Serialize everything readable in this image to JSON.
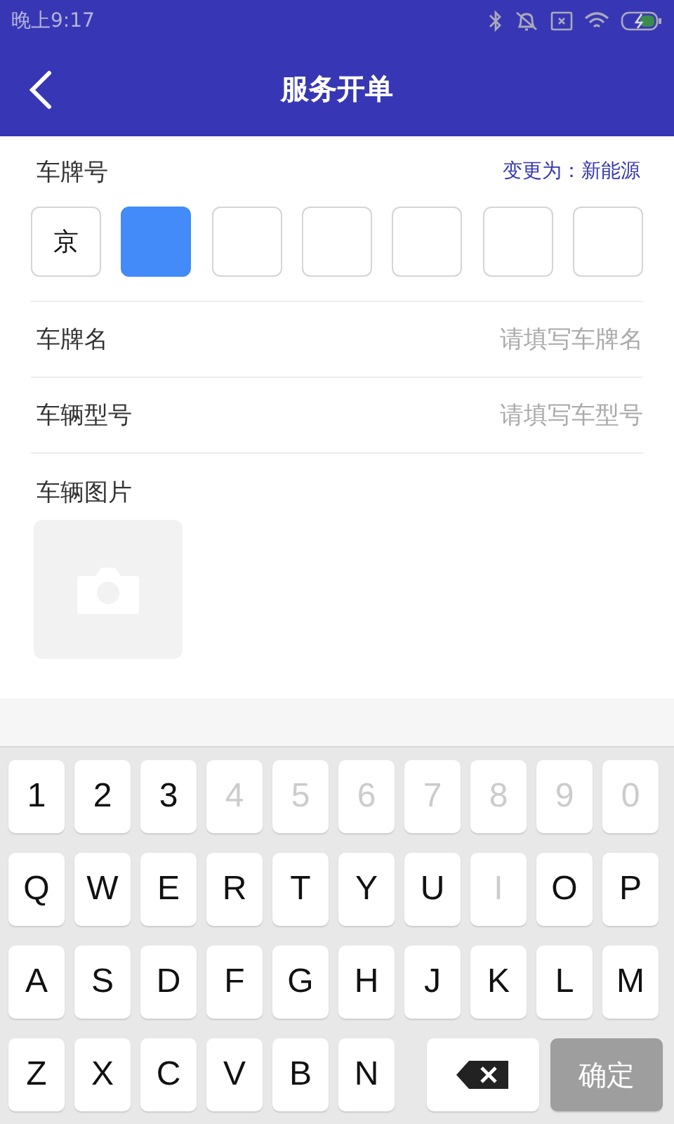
{
  "status_bar": {
    "time": "晚上9:17"
  },
  "header": {
    "title": "服务开单"
  },
  "plate": {
    "label": "车牌号",
    "switch_link": "变更为：新能源",
    "cells": [
      {
        "text": "京",
        "selected": false
      },
      {
        "selected": true
      },
      {
        "selected": false
      },
      {
        "selected": false
      },
      {
        "selected": false
      },
      {
        "selected": false
      },
      {
        "selected": false
      }
    ]
  },
  "fields": [
    {
      "label": "车牌名",
      "placeholder": "请填写车牌名"
    },
    {
      "label": "车辆型号",
      "placeholder": "请填写车型号"
    }
  ],
  "photo": {
    "label": "车辆图片"
  },
  "keyboard": {
    "rows": [
      [
        {
          "kind": "key",
          "label": "1",
          "disabled": false
        },
        {
          "kind": "key",
          "label": "2",
          "disabled": false
        },
        {
          "kind": "key",
          "label": "3",
          "disabled": false
        },
        {
          "kind": "key",
          "label": "4",
          "disabled": true
        },
        {
          "kind": "key",
          "label": "5",
          "disabled": true
        },
        {
          "kind": "key",
          "label": "6",
          "disabled": true
        },
        {
          "kind": "key",
          "label": "7",
          "disabled": true
        },
        {
          "kind": "key",
          "label": "8",
          "disabled": true
        },
        {
          "kind": "key",
          "label": "9",
          "disabled": true
        },
        {
          "kind": "key",
          "label": "0",
          "disabled": true
        }
      ],
      [
        {
          "kind": "key",
          "label": "Q",
          "disabled": false
        },
        {
          "kind": "key",
          "label": "W",
          "disabled": false
        },
        {
          "kind": "key",
          "label": "E",
          "disabled": false
        },
        {
          "kind": "key",
          "label": "R",
          "disabled": false
        },
        {
          "kind": "key",
          "label": "T",
          "disabled": false
        },
        {
          "kind": "key",
          "label": "Y",
          "disabled": false
        },
        {
          "kind": "key",
          "label": "U",
          "disabled": false
        },
        {
          "kind": "key",
          "label": "I",
          "disabled": true
        },
        {
          "kind": "key",
          "label": "O",
          "disabled": false
        },
        {
          "kind": "key",
          "label": "P",
          "disabled": false
        }
      ],
      [
        {
          "kind": "key",
          "label": "A",
          "disabled": false
        },
        {
          "kind": "key",
          "label": "S",
          "disabled": false
        },
        {
          "kind": "key",
          "label": "D",
          "disabled": false
        },
        {
          "kind": "key",
          "label": "F",
          "disabled": false
        },
        {
          "kind": "key",
          "label": "G",
          "disabled": false
        },
        {
          "kind": "key",
          "label": "H",
          "disabled": false
        },
        {
          "kind": "key",
          "label": "J",
          "disabled": false
        },
        {
          "kind": "key",
          "label": "K",
          "disabled": false
        },
        {
          "kind": "key",
          "label": "L",
          "disabled": false
        },
        {
          "kind": "key",
          "label": "M",
          "disabled": false
        }
      ],
      [
        {
          "kind": "key",
          "label": "Z",
          "disabled": false
        },
        {
          "kind": "key",
          "label": "X",
          "disabled": false
        },
        {
          "kind": "key",
          "label": "C",
          "disabled": false
        },
        {
          "kind": "key",
          "label": "V",
          "disabled": false
        },
        {
          "kind": "key",
          "label": "B",
          "disabled": false
        },
        {
          "kind": "key",
          "label": "N",
          "disabled": false
        },
        {
          "kind": "delete"
        },
        {
          "kind": "confirm",
          "label": "确定",
          "disabled": true
        }
      ]
    ]
  }
}
